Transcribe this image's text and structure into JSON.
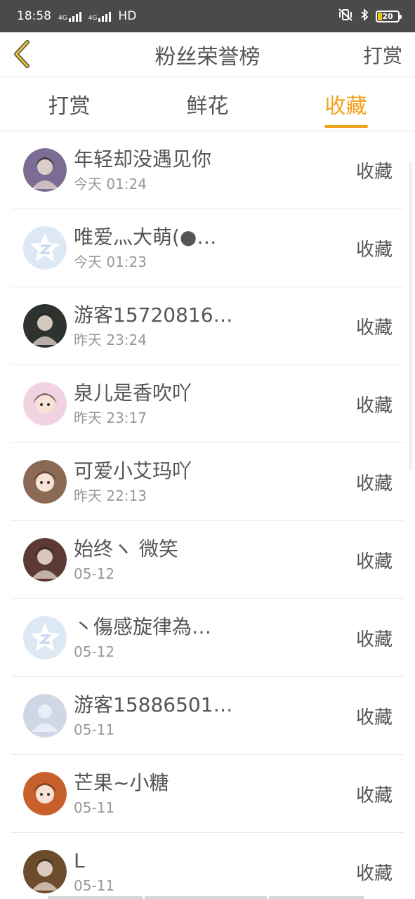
{
  "status": {
    "time": "18:58",
    "net1": "4G",
    "net2": "4G",
    "hd": "HD",
    "battery": "20",
    "battery_color": "#f0c419"
  },
  "nav": {
    "title": "粉丝荣誉榜",
    "action": "打赏",
    "back_icon": "chevron-left-icon",
    "accent": "#f2c230"
  },
  "tabs": [
    {
      "label": "打赏",
      "active": false
    },
    {
      "label": "鲜花",
      "active": false
    },
    {
      "label": "收藏",
      "active": true
    }
  ],
  "accent_color": "#f2a11b",
  "list": [
    {
      "name": "年轻却没遇见你",
      "time": "今天 01:24",
      "action": "收藏",
      "avatar": "photo-avatar",
      "avatar_color": "#7b6c93"
    },
    {
      "name": "唯爱灬大萌(●…",
      "time": "今天 01:23",
      "action": "收藏",
      "avatar": "default-star-avatar",
      "avatar_color": "#dde8f5"
    },
    {
      "name": "游客15720816…",
      "time": "昨天 23:24",
      "action": "收藏",
      "avatar": "photo-avatar",
      "avatar_color": "#2e3330"
    },
    {
      "name": "泉儿是香吹吖",
      "time": "昨天 23:17",
      "action": "收藏",
      "avatar": "anime-avatar",
      "avatar_color": "#f1d2e1"
    },
    {
      "name": "可爱小艾玛吖",
      "time": "昨天 22:13",
      "action": "收藏",
      "avatar": "anime-avatar",
      "avatar_color": "#8b6a55"
    },
    {
      "name": "始终ヽ 微笑",
      "time": "05-12",
      "action": "收藏",
      "avatar": "photo-avatar",
      "avatar_color": "#5b3a36"
    },
    {
      "name": "丶傷感旋律為…",
      "time": "05-12",
      "action": "收藏",
      "avatar": "default-star-avatar",
      "avatar_color": "#dde8f5"
    },
    {
      "name": "游客15886501…",
      "time": "05-11",
      "action": "收藏",
      "avatar": "default-person-avatar",
      "avatar_color": "#cfd6e6"
    },
    {
      "name": "芒果~小糖",
      "time": "05-11",
      "action": "收藏",
      "avatar": "anime-avatar",
      "avatar_color": "#c8602c"
    },
    {
      "name": "L",
      "time": "05-11",
      "action": "收藏",
      "avatar": "photo-avatar",
      "avatar_color": "#6b4c2c"
    }
  ]
}
